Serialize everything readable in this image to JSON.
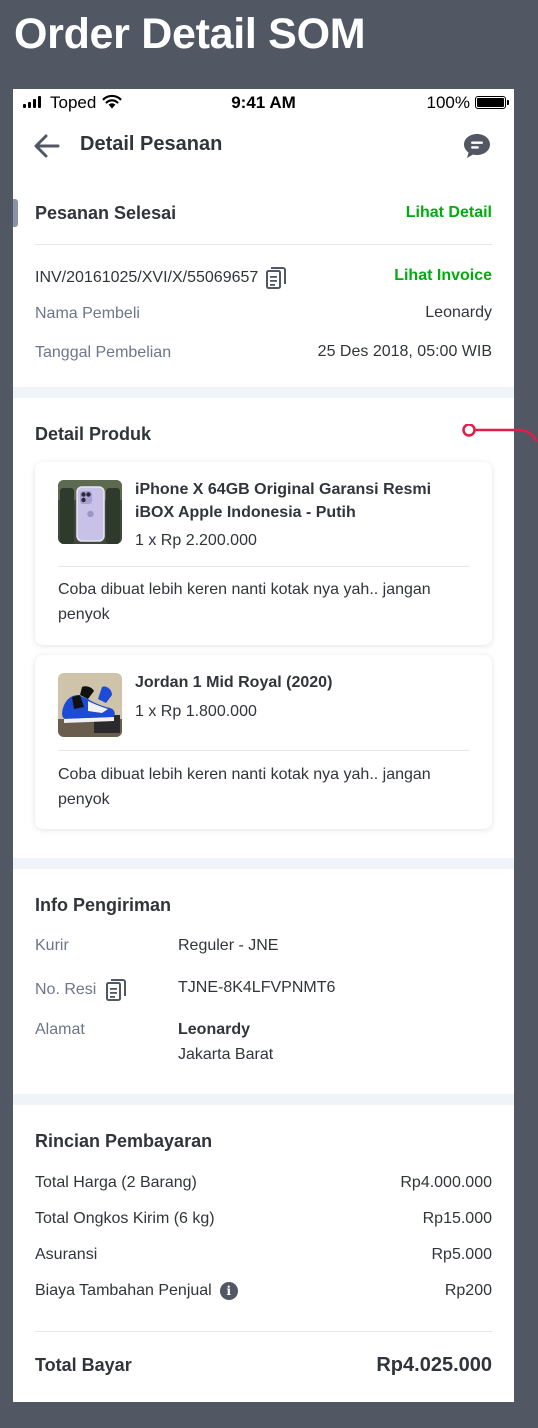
{
  "frame": {
    "heading": "Order Detail SOM"
  },
  "status_bar": {
    "carrier": "Toped",
    "time": "9:41 AM",
    "battery": "100%"
  },
  "navbar": {
    "title": "Detail Pesanan",
    "back_icon": "arrow-left-icon",
    "chat_icon": "chat-bubble-icon"
  },
  "order": {
    "status": "Pesanan Selesai",
    "detail_link": "Lihat Detail",
    "invoice": "INV/20161025/XVI/X/55069657",
    "invoice_link": "Lihat Invoice",
    "buyer_label": "Nama Pembeli",
    "buyer": "Leonardy",
    "date_label": "Tanggal Pembelian",
    "date": "25 Des 2018, 05:00 WIB"
  },
  "products": {
    "title": "Detail Produk",
    "items": [
      {
        "name": "iPhone X 64GB Original Garansi Resmi iBOX Apple Indonesia - Putih",
        "qty_price": "1 x Rp 2.200.000",
        "note": "Coba dibuat lebih keren nanti kotak nya yah.. jangan penyok"
      },
      {
        "name": "Jordan 1 Mid Royal (2020)",
        "qty_price": "1 x Rp 1.800.000",
        "note": "Coba dibuat lebih keren nanti kotak nya yah.. jangan penyok"
      }
    ]
  },
  "shipping": {
    "title": "Info Pengiriman",
    "courier_label": "Kurir",
    "courier": "Reguler - JNE",
    "resi_label": "No. Resi",
    "resi": "TJNE-8K4LFVPNMT6",
    "address_label": "Alamat",
    "address_name": "Leonardy",
    "address_city": "Jakarta Barat"
  },
  "payment": {
    "title": "Rincian Pembayaran",
    "rows": [
      {
        "label": "Total Harga (2 Barang)",
        "value": "Rp4.000.000"
      },
      {
        "label": "Total Ongkos Kirim (6 kg)",
        "value": "Rp15.000"
      },
      {
        "label": "Asuransi",
        "value": "Rp5.000"
      },
      {
        "label": "Biaya Tambahan Penjual",
        "value": "Rp200"
      }
    ],
    "total_label": "Total Bayar",
    "total_value": "Rp4.025.000"
  },
  "colors": {
    "accent_green": "#03ac0e",
    "annotation": "#e11d48",
    "frame_bg": "#525863"
  }
}
